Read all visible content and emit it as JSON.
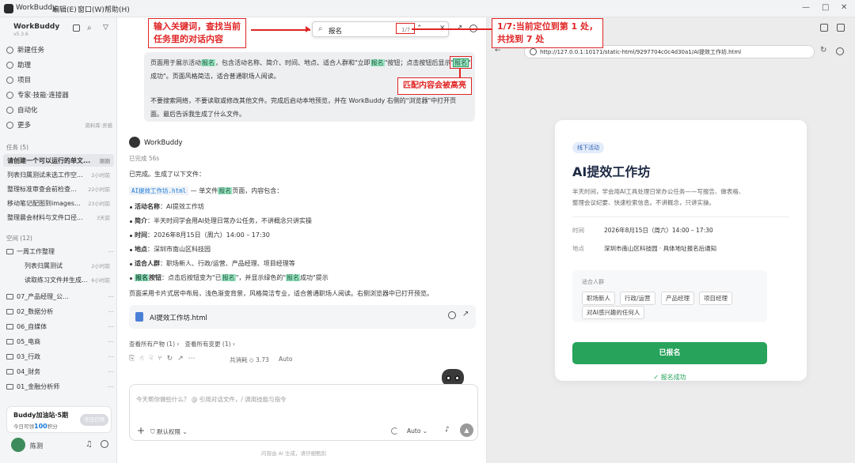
{
  "titlebar": {
    "app_name": "WorkBuddy",
    "menus": [
      "编辑(E)",
      "窗口(W)",
      "帮助(H)"
    ],
    "controls": [
      "—",
      "□",
      "✕"
    ]
  },
  "sidebar": {
    "brand": "WorkBuddy",
    "version": "v5.3.6",
    "nav": [
      {
        "icon": "plus-circle-icon",
        "label": "新建任务"
      },
      {
        "icon": "assistant-icon",
        "label": "助理"
      },
      {
        "icon": "project-icon",
        "label": "项目"
      },
      {
        "icon": "expert-icon",
        "label": "专家·技能·连接器"
      },
      {
        "icon": "automation-icon",
        "label": "自动化"
      },
      {
        "icon": "more-icon",
        "label": "更多",
        "extra": "资料库·灵感"
      }
    ],
    "tasks_header": "任务 (5)",
    "tasks": [
      {
        "title": "请创建一个可以运行的单文...",
        "time": "刚刚",
        "active": true
      },
      {
        "title": "列表归属测试未选工作空...",
        "time": "2小时前"
      },
      {
        "title": "整理标准审查会前检查...",
        "time": "22小时前"
      },
      {
        "title": "移动笔记配图到images...",
        "time": "23小时前"
      },
      {
        "title": "整理晨会材料与文件口径...",
        "time": "3天前"
      }
    ],
    "spaces_header": "空间 (12)",
    "spaces": [
      {
        "name": "一周工作整理",
        "children": [
          {
            "title": "列表归属测试",
            "time": "2小时前"
          },
          {
            "title": "读取练习文件并生成...",
            "time": "6小时前"
          }
        ]
      },
      {
        "name": "07_产品经理_公..."
      },
      {
        "name": "02_数据分析"
      },
      {
        "name": "06_自媒体"
      },
      {
        "name": "05_电商"
      },
      {
        "name": "03_行政"
      },
      {
        "name": "04_财务"
      },
      {
        "name": "01_金融分析师"
      }
    ],
    "promo": {
      "title": "Buddy加油站·5期",
      "sub_prefix": "今日可领",
      "points": "100",
      "sub_suffix": "积分",
      "button": "今日已领"
    },
    "user": "陈测"
  },
  "search": {
    "query": "报名",
    "count": "1/7"
  },
  "chat": {
    "user_msg": {
      "line1_a": "页面用于展示活动",
      "line1_hl": "报名",
      "line1_b": "，包含活动名称、简介、时间、地点、适合人群和\"立即",
      "line1_hl2": "报名",
      "line1_c": "\"按钮；点击按钮后显示\"",
      "line1_hlcur": "报名",
      "line2": "成功\"。页面风格简洁，适合普通职场人阅读。",
      "line3": "不要搜索网络，不要读取或修改其他文件。完成后启动本地预览，并在 WorkBuddy 右侧的\"浏览器\"中打开页",
      "line4": "面。最后告诉我生成了什么文件。"
    },
    "bot_name": "WorkBuddy",
    "status": "已完成 56s",
    "done": "已完成。生成了以下文件：",
    "file_link": "AI提效工作坊.html",
    "file_desc_a": " — 单文件",
    "file_desc_hl": "报名",
    "file_desc_b": "页面，内容包含：",
    "items": [
      {
        "k": "活动名称",
        "v": "：AI提效工作坊"
      },
      {
        "k": "简介",
        "v": "：半天时间学会用AI处理日常办公任务，不讲概念只讲实操"
      },
      {
        "k": "时间",
        "v": "：2026年8月15日（周六）14:00 – 17:30"
      },
      {
        "k": "地点",
        "v": "：深圳市南山区科技园"
      },
      {
        "k": "适合人群",
        "v": "：职场新人、行政/运营、产品经理、项目经理等"
      }
    ],
    "item_last_hl": "报名",
    "item_last_a": "按钮",
    "item_last_b": "：点击后按钮变为\"已",
    "item_last_hl2": "报名",
    "item_last_c": "\"，并显示绿色的\"",
    "item_last_hl3": "报名",
    "item_last_d": "成功\"提示",
    "summary": "页面采用卡片式居中布局，浅色渐变背景，风格简洁专业，适合普通职场人阅读。右侧浏览器中已打开预览。",
    "file_card": "AI提效工作坊.html",
    "links": "查看所有产物 (1) ›   查看所有变更 (1) ›",
    "cost": "共消耗 ◇ 3.73",
    "model": "Auto",
    "input_placeholder": "今天帮你做些什么？ @ 引用对话文件，/ 调用技能与指令",
    "permission": "默认权限",
    "auto": "Auto",
    "footer": "内容由 AI 生成，请仔细甄别"
  },
  "browser": {
    "url": "http://127.0.0.1:10171/static-html/9297704c0c4d30a1/AI提效工作坊.html",
    "card": {
      "badge": "线下活动",
      "title": "AI提效工作坊",
      "intro1": "半天时间，学会用AI工具处理日常办公任务——写报告、做表格、",
      "intro2": "整理会议纪要、快速检索信息。不讲概念，只讲实操。",
      "time_label": "时间",
      "time_value": "2026年8月15日（周六）14:00 – 17:30",
      "place_label": "地点",
      "place_value": "深圳市南山区科技园 · 具体地址报名后通知",
      "audience_label": "适合人群",
      "tags": [
        "职场新人",
        "行政/运营",
        "产品经理",
        "项目经理",
        "对AI感兴趣的任何人"
      ],
      "button": "已报名",
      "success": "✓ 报名成功"
    }
  },
  "annotations": {
    "a1_l1": "输入关键词，查找当前",
    "a1_l2": "任务里的对话内容",
    "a2_l1": "1/7:当前定位到第 1 处，",
    "a2_l2": "共找到 7 处",
    "a3": "匹配内容会被高亮"
  }
}
